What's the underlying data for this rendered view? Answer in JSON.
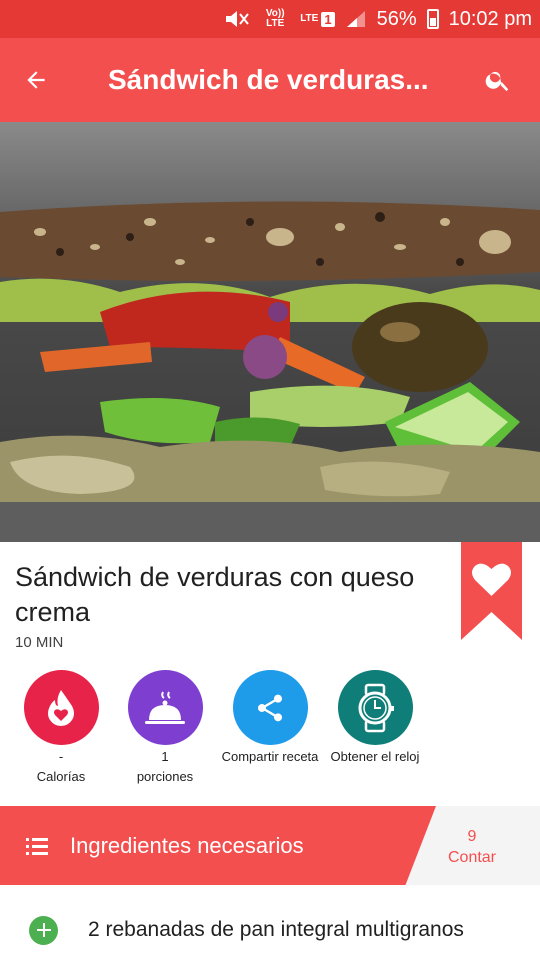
{
  "status_bar": {
    "volte": "Vo)) LTE",
    "lte": "LTE",
    "sim": "1",
    "battery": "56%",
    "time": "10:02 pm"
  },
  "app_bar": {
    "title": "Sándwich de verduras...",
    "back_icon": "arrow-back-icon",
    "search_icon": "search-icon"
  },
  "recipe": {
    "title": "Sándwich de verduras con queso crema",
    "time": "10 MIN"
  },
  "actions": [
    {
      "value": "-",
      "label": "Calorías",
      "icon": "flame-heart-icon",
      "color": "#e8234a"
    },
    {
      "value": "1",
      "label": "porciones",
      "icon": "cloche-icon",
      "color": "#7e3fd1"
    },
    {
      "value": "",
      "label": "Compartir receta",
      "icon": "share-icon",
      "color": "#1e9be9"
    },
    {
      "value": "",
      "label": "Obtener el reloj",
      "icon": "watch-icon",
      "color": "#0f7e78"
    }
  ],
  "ingredients_header": {
    "label": "Ingredientes necesarios",
    "count": "9",
    "count_label": "Contar"
  },
  "ingredients": [
    {
      "text": "2 rebanadas de pan integral multigranos"
    }
  ],
  "colors": {
    "status_bar": "#e53935",
    "app_bar": "#f44f4f",
    "accent": "#f44f4f",
    "add_button": "#4caf50"
  }
}
